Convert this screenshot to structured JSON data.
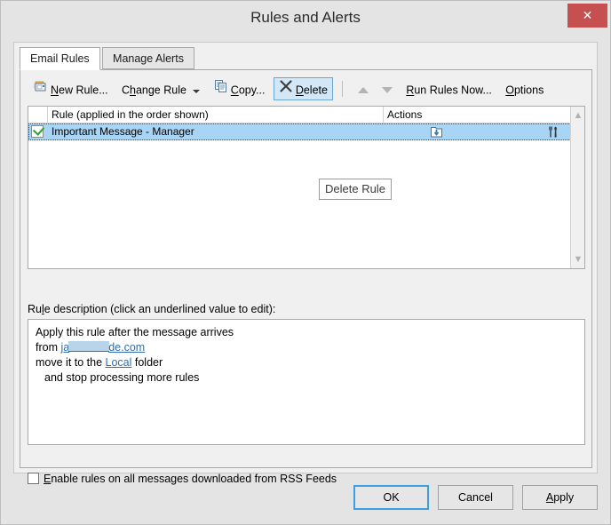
{
  "window": {
    "title": "Rules and Alerts",
    "close_label": "✕"
  },
  "tabs": [
    {
      "label": "Email Rules",
      "active": true
    },
    {
      "label": "Manage Alerts",
      "active": false
    }
  ],
  "toolbar": {
    "new_rule": "New Rule...",
    "change_rule": "Change Rule",
    "copy": "Copy...",
    "delete": "Delete",
    "move_up": "Move Up",
    "move_down": "Move Down",
    "run_rules_now": "Run Rules Now...",
    "options": "Options"
  },
  "tooltip": {
    "text": "Delete Rule"
  },
  "rules_list": {
    "columns": [
      "",
      "Rule (applied in the order shown)",
      "Actions"
    ],
    "rows": [
      {
        "enabled": true,
        "name": "Important Message - Manager",
        "actions": [
          "move-to-folder-icon",
          "tools-icon"
        ],
        "selected": true
      }
    ]
  },
  "description": {
    "label": "Rule description (click an underlined value to edit):",
    "lines": [
      {
        "text": "Apply this rule after the message arrives"
      },
      {
        "prefix": "from ",
        "link_start": "ja",
        "redacted": true,
        "link_end": "de.com"
      },
      {
        "prefix": "move it to the ",
        "link": "Local",
        "suffix": " folder"
      },
      {
        "text": "and stop processing more rules",
        "indent": true
      }
    ]
  },
  "rss": {
    "label": "Enable rules on all messages downloaded from RSS Feeds",
    "checked": false
  },
  "footer": {
    "ok": "OK",
    "cancel": "Cancel",
    "apply": "Apply"
  },
  "colors": {
    "accent": "#3c9fe0",
    "selection": "#a8d4f5",
    "close": "#c65050",
    "link": "#2f6fad",
    "check": "#2fa02f"
  }
}
